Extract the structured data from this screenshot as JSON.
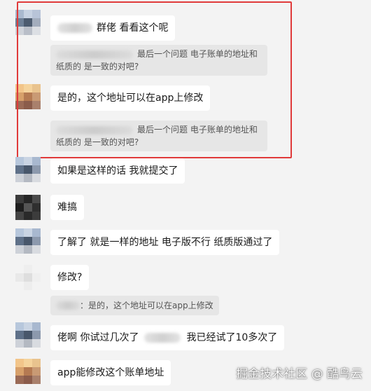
{
  "messages": [
    {
      "text": "群佬 看看这个呢"
    },
    {
      "quote": "最后一个问题 电子账单的地址和纸质的 是一致的对吧?"
    },
    {
      "text": "是的，这个地址可以在app上修改"
    },
    {
      "quote": "最后一个问题 电子账单的地址和纸质的 是一致的对吧?"
    },
    {
      "text": "如果是这样的话 我就提交了"
    },
    {
      "text": "难搞"
    },
    {
      "text": "了解了 就是一样的地址 电子版不行 纸质版通过了"
    },
    {
      "text": "修改?"
    },
    {
      "quote": "：是的，这个地址可以在app上修改"
    },
    {
      "text_before": "佬啊 你试过几次了",
      "text_after": "我已经试了10多次了"
    },
    {
      "text": "app能修改这个账单地址"
    }
  ],
  "watermark": "掘金技术社区 @ 酷鸟云",
  "colors": {
    "highlight": "#e03a3a",
    "bubble": "#ffffff",
    "quote": "#e6e6e6",
    "background": "#f3f3f3"
  }
}
